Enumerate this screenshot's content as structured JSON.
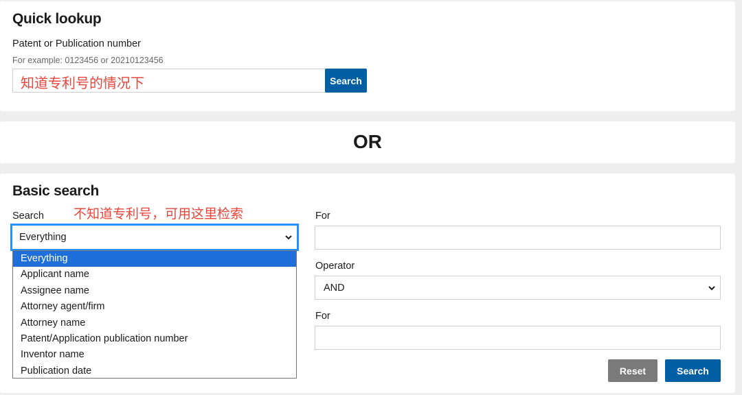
{
  "quick_lookup": {
    "title": "Quick lookup",
    "field_label": "Patent or Publication number",
    "hint": "For example: 0123456 or 20210123456",
    "input_value": "",
    "annotation": "知道专利号的情况下",
    "search_label": "Search"
  },
  "or_divider": {
    "text": "OR"
  },
  "basic_search": {
    "title": "Basic search",
    "search_label": "Search",
    "annotation": "不知道专利号，可用这里检索",
    "field_select_value": "Everything",
    "field_options": [
      "Everything",
      "Applicant name",
      "Assignee name",
      "Attorney agent/firm",
      "Attorney name",
      "Patent/Application publication number",
      "Inventor name",
      "Publication date"
    ],
    "for_label_1": "For",
    "for_value_1": "",
    "operator_label": "Operator",
    "operator_value": "AND",
    "for_label_2": "For",
    "for_value_2": "",
    "reset_label": "Reset",
    "search_button_label": "Search"
  },
  "colors": {
    "primary": "#005ea2",
    "reset": "#7a7a7a",
    "focus": "#2491ff",
    "option_selected": "#1e6fd9",
    "annotation": "#e8453c"
  },
  "icons": {
    "select_chevron": "chevron-down-icon"
  }
}
